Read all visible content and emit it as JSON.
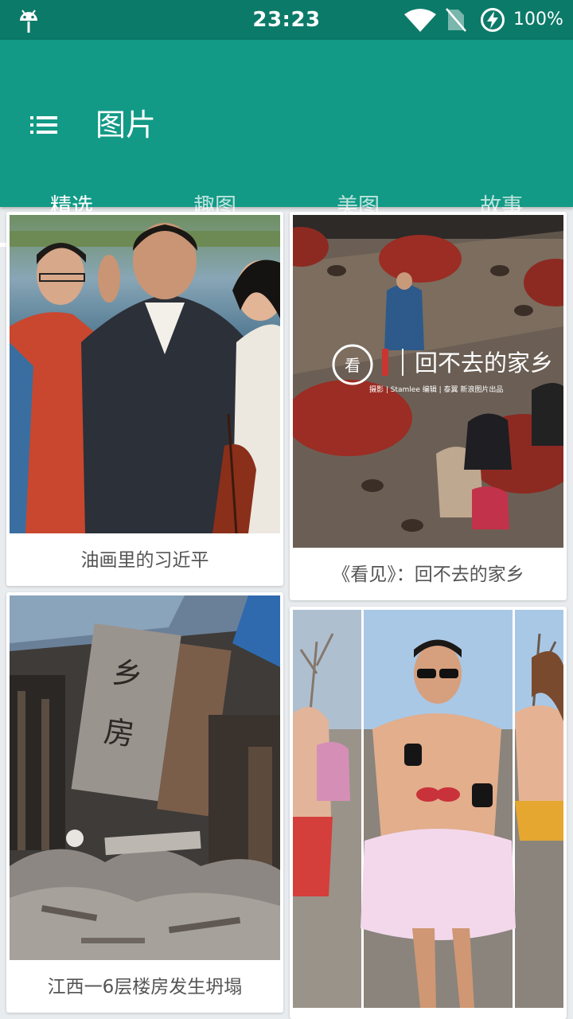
{
  "status_bar": {
    "time": "23:23",
    "battery": "100%",
    "icons": [
      "android-icon",
      "wifi-icon",
      "no-sim-icon",
      "battery-charging-icon"
    ]
  },
  "app_bar": {
    "title": "图片",
    "menu_icon": "list-menu-icon"
  },
  "tabs": [
    {
      "label": "精选",
      "active": true
    },
    {
      "label": "趣图",
      "active": false
    },
    {
      "label": "美图",
      "active": false
    },
    {
      "label": "故事",
      "active": false
    }
  ],
  "cards": [
    {
      "caption": "油画里的习近平"
    },
    {
      "caption": "《看见》：回不去的家乡",
      "overlay_title": "回不去的家乡",
      "overlay_sub": "摄影 | Stamlee 编辑 | 泰翼 新浪图片出品"
    },
    {
      "caption": "江西一6层楼房发生坍塌",
      "sign_text": "乡房"
    },
    {
      "caption": ""
    }
  ],
  "colors": {
    "status_bar": "#0c7a69",
    "app_bar": "#129a86",
    "background": "#e9ecee"
  }
}
